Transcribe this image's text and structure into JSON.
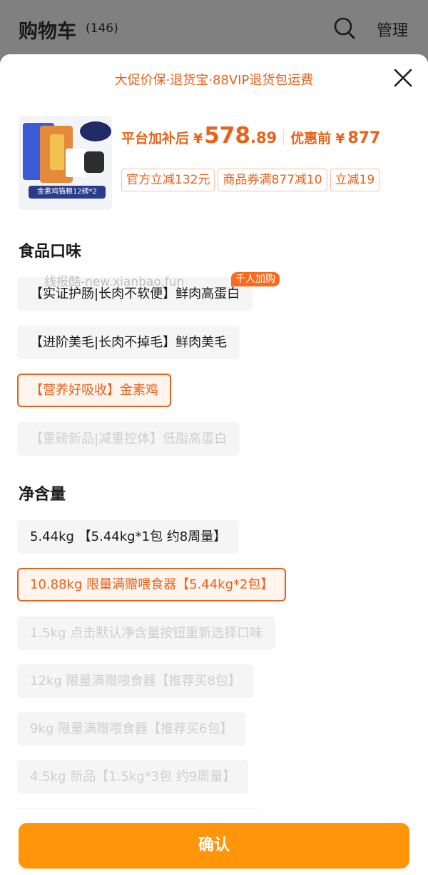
{
  "header": {
    "title": "购物车",
    "count": "(146)",
    "manage_label": "管理"
  },
  "sheet": {
    "promo": "大促价保·退货宝·88VIP退货包运费",
    "product": {
      "thumb_band": "金素鸡猫粮12磅*2",
      "price_prefix": "平台加补后",
      "currency": "¥",
      "price_int": "578",
      "price_dec": ".89",
      "orig_label": "优惠前",
      "orig_price": "877",
      "coupons": [
        "官方立减132元",
        "商品券满877减10",
        "立减19"
      ]
    },
    "flavor": {
      "title": "食品口味",
      "badge": "千人加购",
      "watermark": "线报酷-new.xianbao.fun",
      "options": [
        "【实证护肠|长肉不软便】鲜肉高蛋白",
        "【进阶美毛|长肉不掉毛】鲜肉美毛",
        "【营养好吸收】金素鸡",
        "【重磅新品|减重控体】低脂高蛋白"
      ]
    },
    "weight": {
      "title": "净含量",
      "options": [
        "5.44kg 【5.44kg*1包 约8周量】",
        "10.88kg 限量满赠喂食器【5.44kg*2包】",
        "1.5kg 点击默认净含量按钮重新选择口味",
        "12kg 限量满赠喂食器【推荐买8包】",
        "9kg 限量满赠喂食器【推荐买6包】",
        "4.5kg 新品【1.5kg*3包 约9周量】"
      ]
    },
    "confirm_label": "确认"
  },
  "colors": {
    "accent": "#e8621a",
    "button": "#ff9508",
    "badge": "#ff6a1a"
  }
}
